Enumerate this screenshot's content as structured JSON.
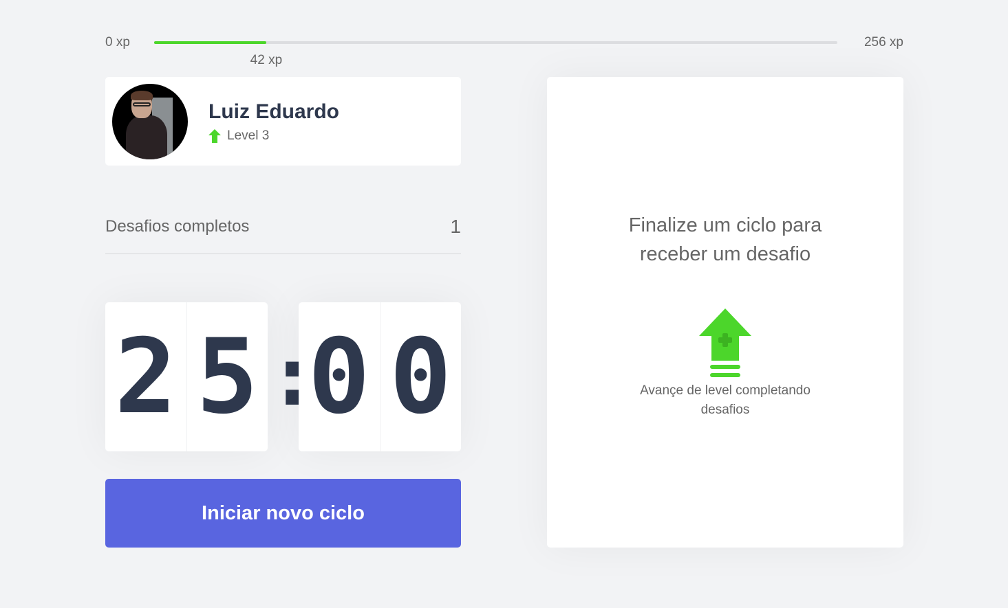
{
  "xp": {
    "min_label": "0 xp",
    "max_label": "256 xp",
    "current_label": "42 xp",
    "current": 42,
    "max": 256,
    "bar_color": "#4cd62b"
  },
  "profile": {
    "name": "Luiz Eduardo",
    "level_label": "Level 3",
    "level_icon": "level-up-arrow-icon"
  },
  "challenges": {
    "label": "Desafios completos",
    "count": "1"
  },
  "countdown": {
    "minute_left": "2",
    "minute_right": "5",
    "separator": ":",
    "second_left": "0",
    "second_right": "0"
  },
  "start_button": {
    "label": "Iniciar novo ciclo",
    "color": "#5965e0"
  },
  "challenge_box": {
    "title": "Finalize um ciclo para receber um desafio",
    "icon": "level-up-icon",
    "text": "Avançe de level completando desafios"
  },
  "colors": {
    "background": "#f2f3f5",
    "accent_green": "#4cd62b",
    "title": "#2e384d",
    "text": "#666666"
  }
}
